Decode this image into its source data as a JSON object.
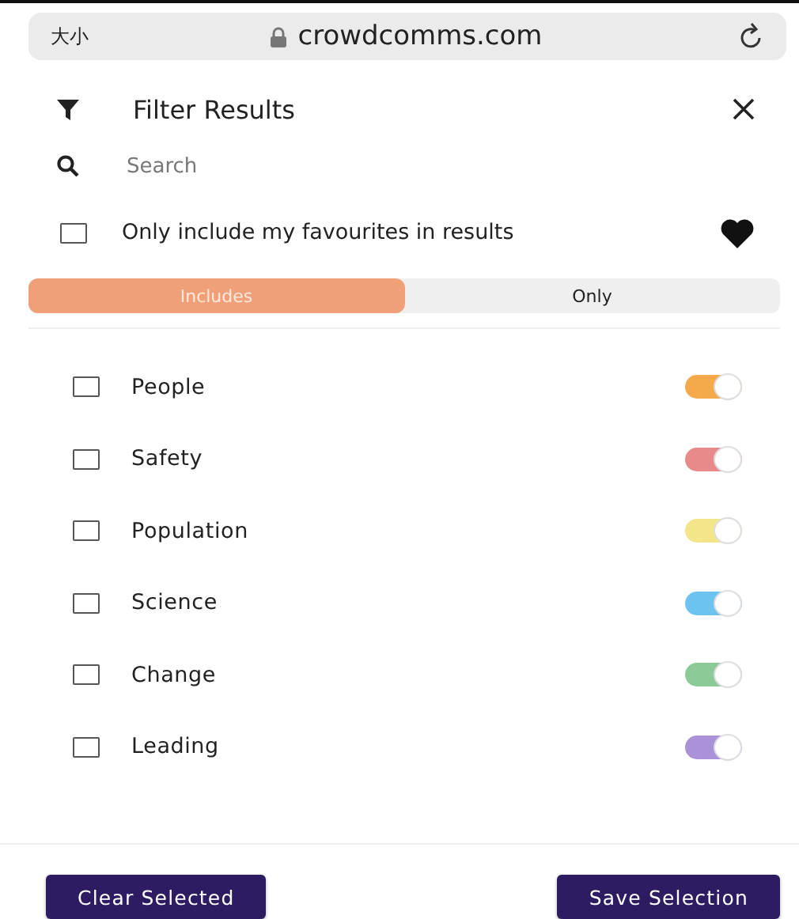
{
  "browser": {
    "text_size": "大小",
    "address": "crowdcomms.com"
  },
  "header": {
    "title": "Filter Results"
  },
  "search": {
    "placeholder": "Search"
  },
  "favourites": {
    "label": "Only include my favourites in results",
    "checked": false
  },
  "segments": [
    {
      "label": "Includes",
      "selected": true
    },
    {
      "label": "Only",
      "selected": false
    }
  ],
  "categories": [
    {
      "label": "People",
      "checked": false,
      "color": "#f5a94a"
    },
    {
      "label": "Safety",
      "checked": false,
      "color": "#e88a8a"
    },
    {
      "label": "Population",
      "checked": false,
      "color": "#f3e68a"
    },
    {
      "label": "Science",
      "checked": false,
      "color": "#6cc3ef"
    },
    {
      "label": "Change",
      "checked": false,
      "color": "#8ccb98"
    },
    {
      "label": "Leading",
      "checked": false,
      "color": "#ab92d8"
    }
  ],
  "buttons": [
    {
      "label": "Clear Selected"
    },
    {
      "label": "Save Selection"
    }
  ]
}
